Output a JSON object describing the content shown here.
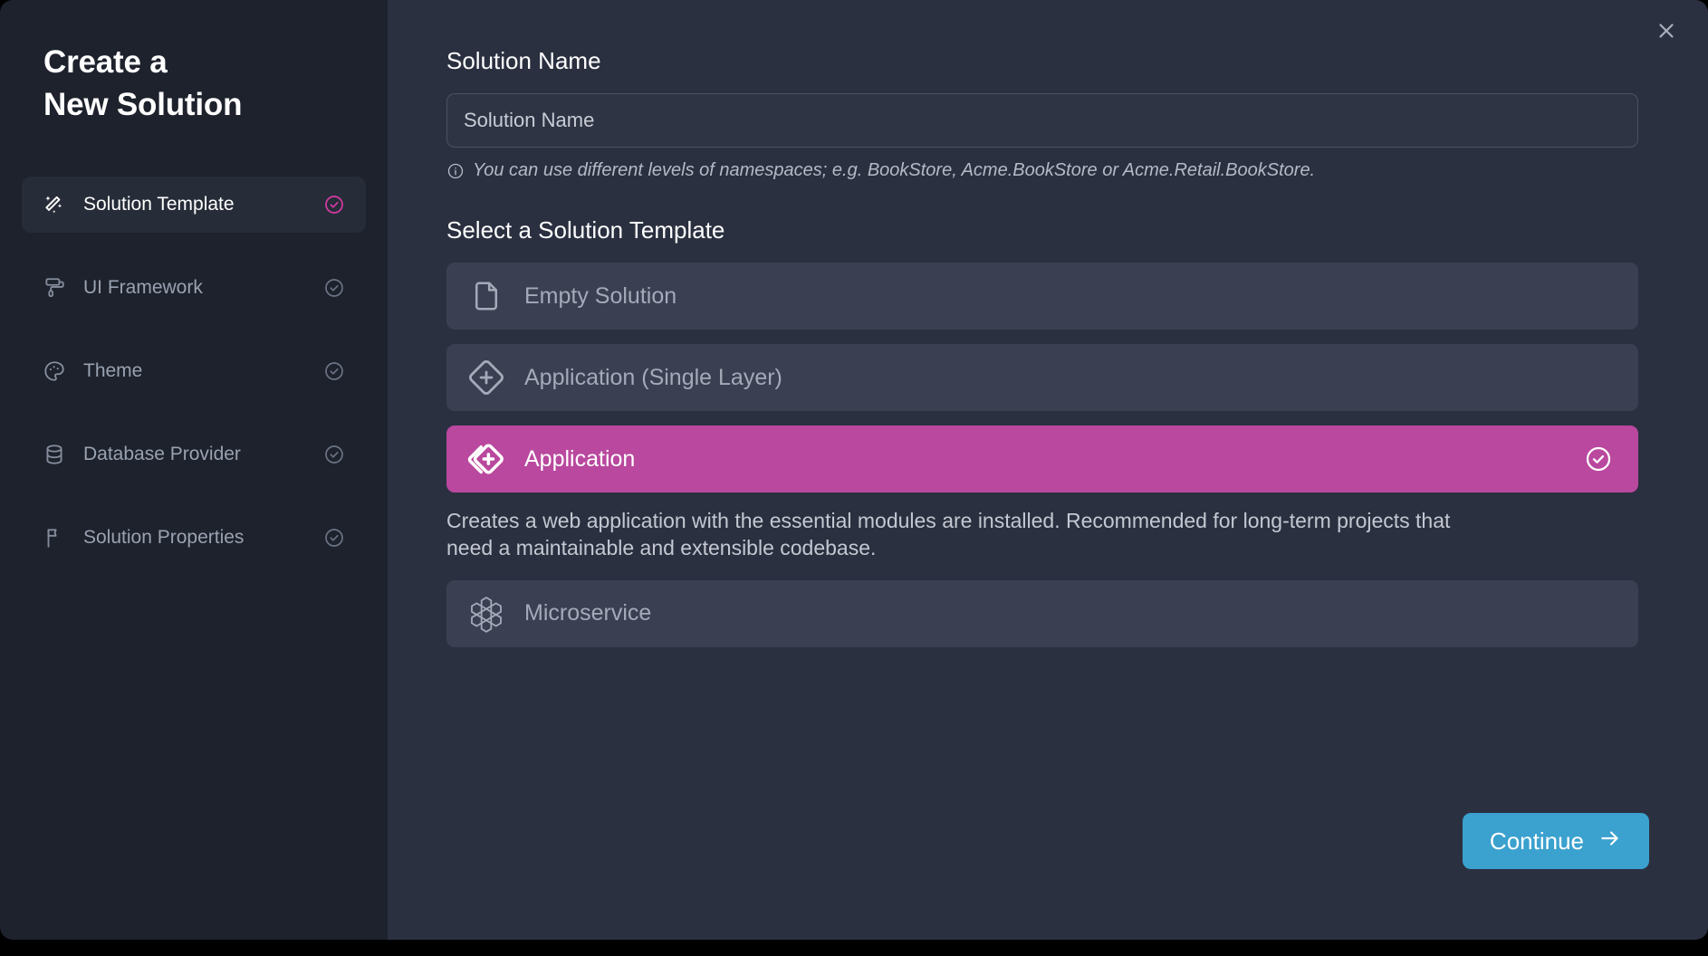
{
  "window": {
    "close_icon": "close-x-icon"
  },
  "sidebar": {
    "title_line1": "Create a",
    "title_line2": "New Solution",
    "items": [
      {
        "label": "Solution Template",
        "icon": "magic-wand-icon",
        "active": true,
        "check_icon": "check-circle-icon"
      },
      {
        "label": "UI Framework",
        "icon": "paint-roller-icon",
        "active": false,
        "check_icon": "check-circle-icon"
      },
      {
        "label": "Theme",
        "icon": "palette-icon",
        "active": false,
        "check_icon": "check-circle-icon"
      },
      {
        "label": "Database Provider",
        "icon": "database-icon",
        "active": false,
        "check_icon": "check-circle-icon"
      },
      {
        "label": "Solution Properties",
        "icon": "flag-icon",
        "active": false,
        "check_icon": "check-circle-icon"
      }
    ]
  },
  "main": {
    "name_field": {
      "label": "Solution Name",
      "value": "",
      "placeholder": "Solution Name"
    },
    "hint": {
      "icon": "info-circle-icon",
      "text": "You can use different levels of namespaces; e.g. BookStore, Acme.BookStore or Acme.Retail.BookStore."
    },
    "section_title": "Select a Solution Template",
    "templates": [
      {
        "label": "Empty Solution",
        "icon": "file-icon",
        "selected": false
      },
      {
        "label": "Application (Single Layer)",
        "icon": "diamond-plus-icon",
        "selected": false
      },
      {
        "label": "Application",
        "icon": "double-diamond-plus-icon",
        "selected": true,
        "description": "Creates a web application with the essential modules are installed. Recommended for long-term projects that need a maintainable and extensible codebase."
      },
      {
        "label": "Microservice",
        "icon": "hex-cluster-icon",
        "selected": false
      }
    ],
    "continue_button": {
      "label": "Continue",
      "icon": "arrow-right-icon"
    }
  },
  "colors": {
    "accent_pink": "#b9489e",
    "accent_blue": "#3ba1ce",
    "sidebar_bg": "#1d222c",
    "panel_bg": "#2b3040",
    "card_bg": "#3a4052"
  }
}
